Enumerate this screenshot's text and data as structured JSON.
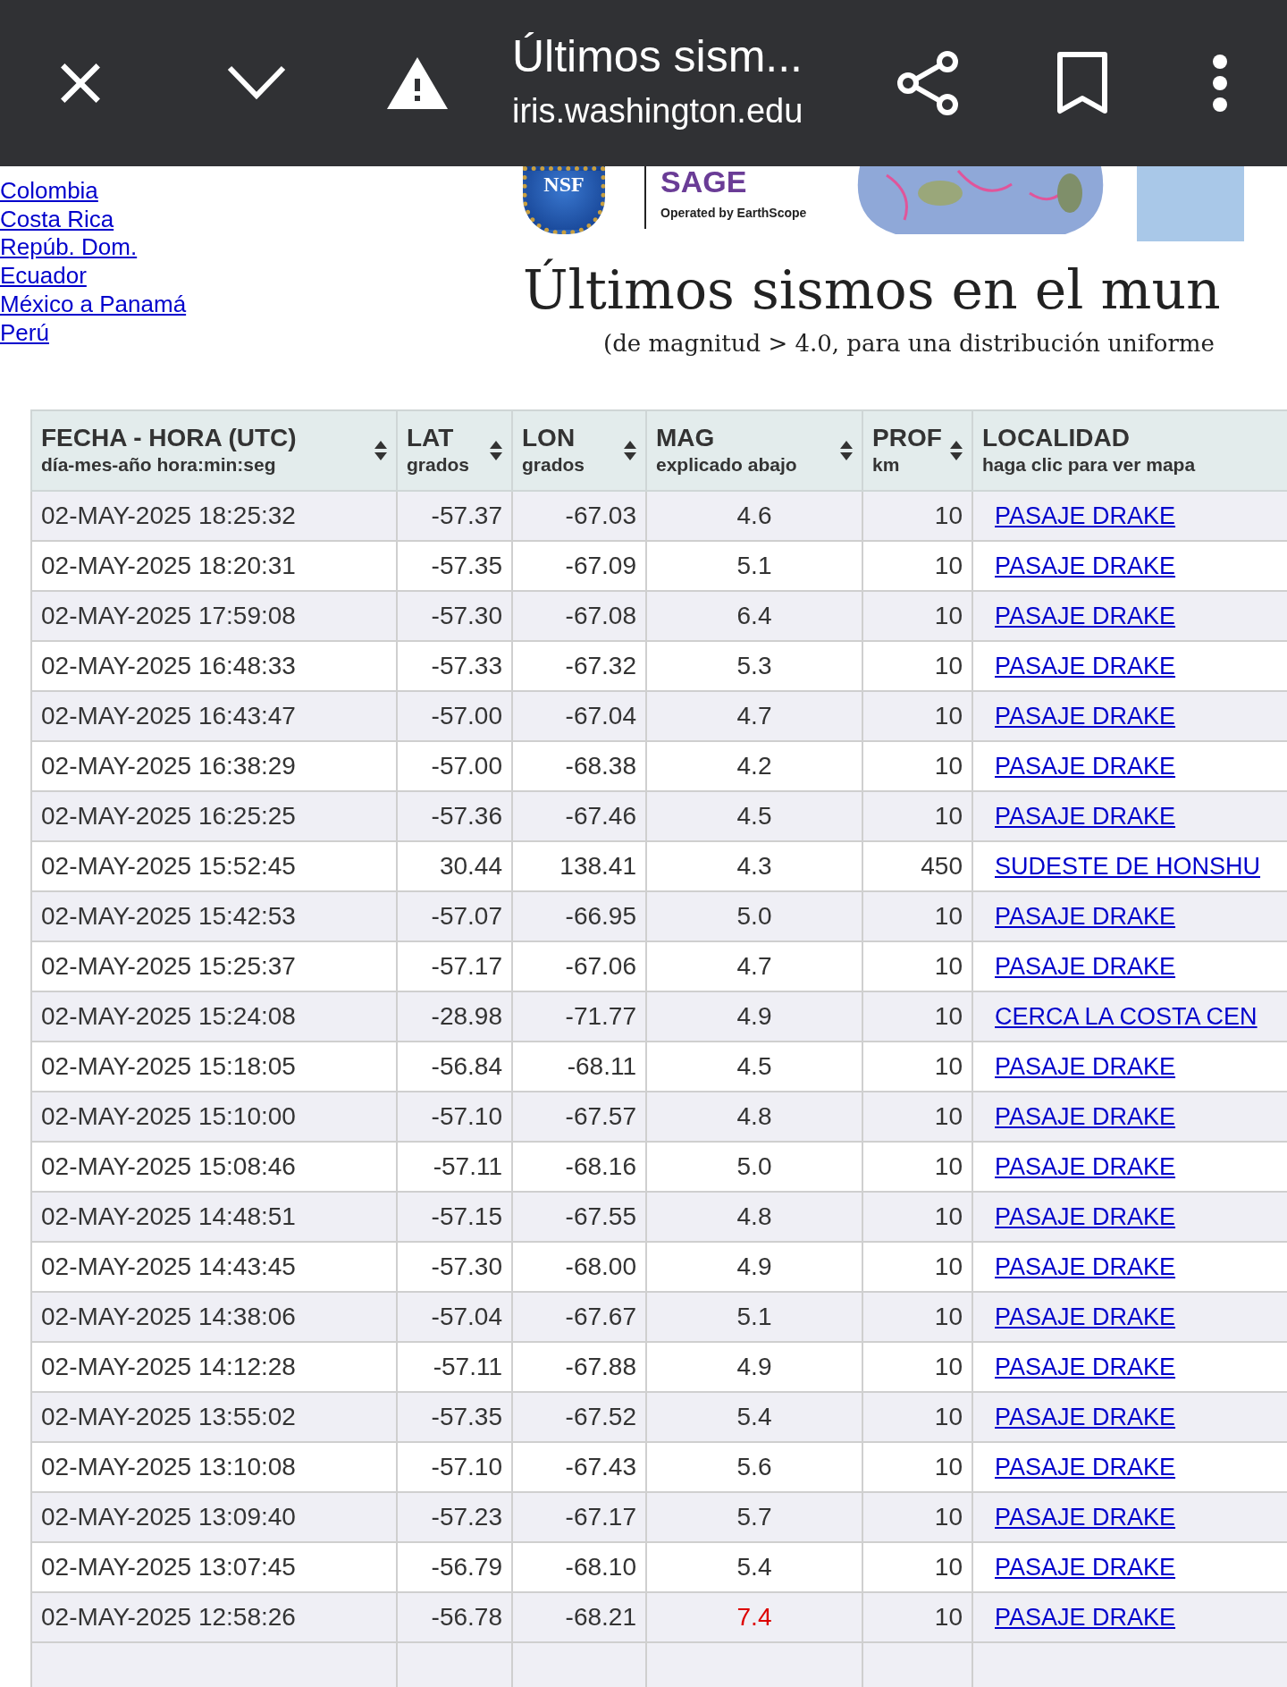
{
  "browser_bar": {
    "title": "Últimos sism...",
    "url": "iris.washington.edu"
  },
  "region_links": [
    "Colombia",
    "Costa Rica",
    "Repúb. Dom.",
    "Ecuador",
    "México a Panamá",
    "Perú"
  ],
  "logo": {
    "nsf_text": "NSF",
    "sage_text": "SAGE",
    "operated_by": "Operated by EarthScope"
  },
  "heading": "Últimos sismos en el mun",
  "subtitle": "(de magnitud > 4.0, para una distribución uniforme",
  "table": {
    "columns": [
      {
        "title": "FECHA - HORA (UTC)",
        "subtitle": "día-mes-año hora:min:seg",
        "sortable": true
      },
      {
        "title": "LAT",
        "subtitle": "grados",
        "sortable": true
      },
      {
        "title": "LON",
        "subtitle": "grados",
        "sortable": true
      },
      {
        "title": "MAG",
        "subtitle": "explicado abajo",
        "sortable": true
      },
      {
        "title": "PROF",
        "subtitle": "km",
        "sortable": true
      },
      {
        "title": "LOCALIDAD",
        "subtitle": "haga clic para ver mapa",
        "sortable": false
      }
    ],
    "rows": [
      {
        "time": "02-MAY-2025 18:25:32",
        "lat": "-57.37",
        "lon": "-67.03",
        "mag": "4.6",
        "depth": "10",
        "place": "PASAJE DRAKE",
        "color": "#333333"
      },
      {
        "time": "02-MAY-2025 18:20:31",
        "lat": "-57.35",
        "lon": "-67.09",
        "mag": "5.1",
        "depth": "10",
        "place": "PASAJE DRAKE",
        "color": "#333333"
      },
      {
        "time": "02-MAY-2025 17:59:08",
        "lat": "-57.30",
        "lon": "-67.08",
        "mag": "6.4",
        "depth": "10",
        "place": "PASAJE DRAKE",
        "color": "#333333"
      },
      {
        "time": "02-MAY-2025 16:48:33",
        "lat": "-57.33",
        "lon": "-67.32",
        "mag": "5.3",
        "depth": "10",
        "place": "PASAJE DRAKE",
        "color": "#333333"
      },
      {
        "time": "02-MAY-2025 16:43:47",
        "lat": "-57.00",
        "lon": "-67.04",
        "mag": "4.7",
        "depth": "10",
        "place": "PASAJE DRAKE",
        "color": "#333333"
      },
      {
        "time": "02-MAY-2025 16:38:29",
        "lat": "-57.00",
        "lon": "-68.38",
        "mag": "4.2",
        "depth": "10",
        "place": "PASAJE DRAKE",
        "color": "#333333"
      },
      {
        "time": "02-MAY-2025 16:25:25",
        "lat": "-57.36",
        "lon": "-67.46",
        "mag": "4.5",
        "depth": "10",
        "place": "PASAJE DRAKE",
        "color": "#333333"
      },
      {
        "time": "02-MAY-2025 15:52:45",
        "lat": "30.44",
        "lon": "138.41",
        "mag": "4.3",
        "depth": "450",
        "place": "SUDESTE DE HONSHU",
        "color": "#333333"
      },
      {
        "time": "02-MAY-2025 15:42:53",
        "lat": "-57.07",
        "lon": "-66.95",
        "mag": "5.0",
        "depth": "10",
        "place": "PASAJE DRAKE",
        "color": "#333333"
      },
      {
        "time": "02-MAY-2025 15:25:37",
        "lat": "-57.17",
        "lon": "-67.06",
        "mag": "4.7",
        "depth": "10",
        "place": "PASAJE DRAKE",
        "color": "#333333"
      },
      {
        "time": "02-MAY-2025 15:24:08",
        "lat": "-28.98",
        "lon": "-71.77",
        "mag": "4.9",
        "depth": "10",
        "place": "CERCA LA COSTA CEN",
        "color": "#333333"
      },
      {
        "time": "02-MAY-2025 15:18:05",
        "lat": "-56.84",
        "lon": "-68.11",
        "mag": "4.5",
        "depth": "10",
        "place": "PASAJE DRAKE",
        "color": "#333333"
      },
      {
        "time": "02-MAY-2025 15:10:00",
        "lat": "-57.10",
        "lon": "-67.57",
        "mag": "4.8",
        "depth": "10",
        "place": "PASAJE DRAKE",
        "color": "#333333"
      },
      {
        "time": "02-MAY-2025 15:08:46",
        "lat": "-57.11",
        "lon": "-68.16",
        "mag": "5.0",
        "depth": "10",
        "place": "PASAJE DRAKE",
        "color": "#333333"
      },
      {
        "time": "02-MAY-2025 14:48:51",
        "lat": "-57.15",
        "lon": "-67.55",
        "mag": "4.8",
        "depth": "10",
        "place": "PASAJE DRAKE",
        "color": "#333333"
      },
      {
        "time": "02-MAY-2025 14:43:45",
        "lat": "-57.30",
        "lon": "-68.00",
        "mag": "4.9",
        "depth": "10",
        "place": "PASAJE DRAKE",
        "color": "#333333"
      },
      {
        "time": "02-MAY-2025 14:38:06",
        "lat": "-57.04",
        "lon": "-67.67",
        "mag": "5.1",
        "depth": "10",
        "place": "PASAJE DRAKE",
        "color": "#333333"
      },
      {
        "time": "02-MAY-2025 14:12:28",
        "lat": "-57.11",
        "lon": "-67.88",
        "mag": "4.9",
        "depth": "10",
        "place": "PASAJE DRAKE",
        "color": "#333333"
      },
      {
        "time": "02-MAY-2025 13:55:02",
        "lat": "-57.35",
        "lon": "-67.52",
        "mag": "5.4",
        "depth": "10",
        "place": "PASAJE DRAKE",
        "color": "#333333"
      },
      {
        "time": "02-MAY-2025 13:10:08",
        "lat": "-57.10",
        "lon": "-67.43",
        "mag": "5.6",
        "depth": "10",
        "place": "PASAJE DRAKE",
        "color": "#333333"
      },
      {
        "time": "02-MAY-2025 13:09:40",
        "lat": "-57.23",
        "lon": "-67.17",
        "mag": "5.7",
        "depth": "10",
        "place": "PASAJE DRAKE",
        "color": "#333333"
      },
      {
        "time": "02-MAY-2025 13:07:45",
        "lat": "-56.79",
        "lon": "-68.10",
        "mag": "5.4",
        "depth": "10",
        "place": "PASAJE DRAKE",
        "color": "#333333"
      },
      {
        "time": "02-MAY-2025 12:58:26",
        "lat": "-56.78",
        "lon": "-68.21",
        "mag": "7.4",
        "depth": "10",
        "place": "PASAJE DRAKE",
        "color": "#dd0000"
      }
    ]
  }
}
